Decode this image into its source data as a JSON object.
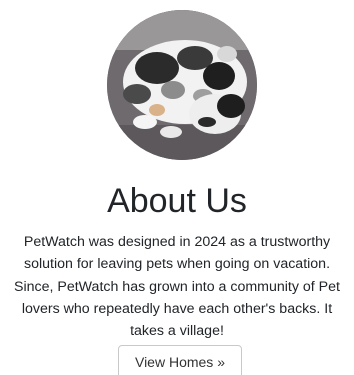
{
  "about": {
    "heading": "About Us",
    "description": "PetWatch was designed in 2024 as a trustworthy solution for leaving pets when going on vacation. Since, PetWatch has grown into a community of Pet lovers who repeatedly have each other's backs. It takes a village!",
    "button_label": "View Homes »"
  },
  "colors": {
    "text": "#212529",
    "button_border": "#c9c9c9",
    "background": "#ffffff"
  }
}
